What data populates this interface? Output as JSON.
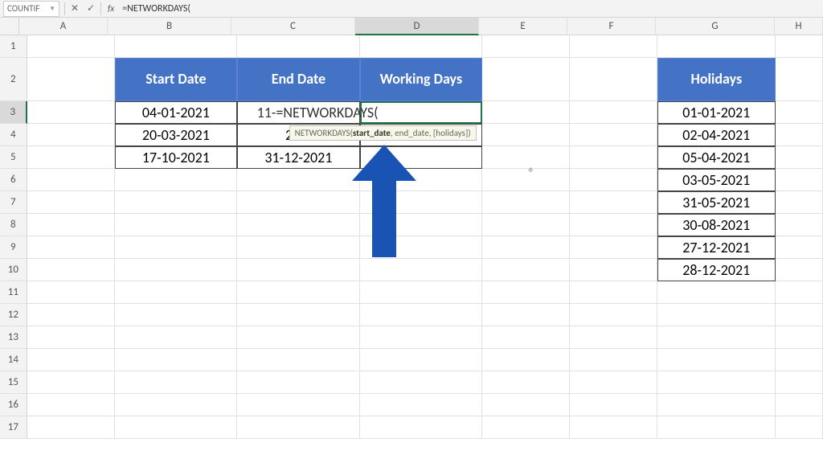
{
  "name_box": "COUNTIF",
  "formula_bar": "=NETWORKDAYS(",
  "columns": [
    "A",
    "B",
    "C",
    "D",
    "E",
    "F",
    "G",
    "H"
  ],
  "active_column": "D",
  "active_row": 3,
  "row_numbers": [
    1,
    2,
    3,
    4,
    5,
    6,
    7,
    8,
    9,
    10,
    11,
    12,
    13,
    14,
    15,
    16,
    17
  ],
  "table1": {
    "headers": {
      "b": "Start Date",
      "c": "End Date",
      "d": "Working Days"
    },
    "rows": [
      {
        "start": "04-01-2021",
        "end": "11-",
        "formula_display": "=NETWORKDAYS("
      },
      {
        "start": "20-03-2021",
        "end": "20-0"
      },
      {
        "start": "17-10-2021",
        "end": "31-12-2021"
      }
    ]
  },
  "holidays": {
    "header": "Holidays",
    "dates": [
      "01-01-2021",
      "02-04-2021",
      "05-04-2021",
      "03-05-2021",
      "31-05-2021",
      "30-08-2021",
      "27-12-2021",
      "28-12-2021"
    ]
  },
  "tooltip": {
    "fn": "NETWORKDAYS(",
    "arg1": "start_date",
    "rest": ", end_date, [holidays])"
  },
  "icon_labels": {
    "cancel": "✕",
    "confirm": "✓",
    "fx": "fx"
  }
}
